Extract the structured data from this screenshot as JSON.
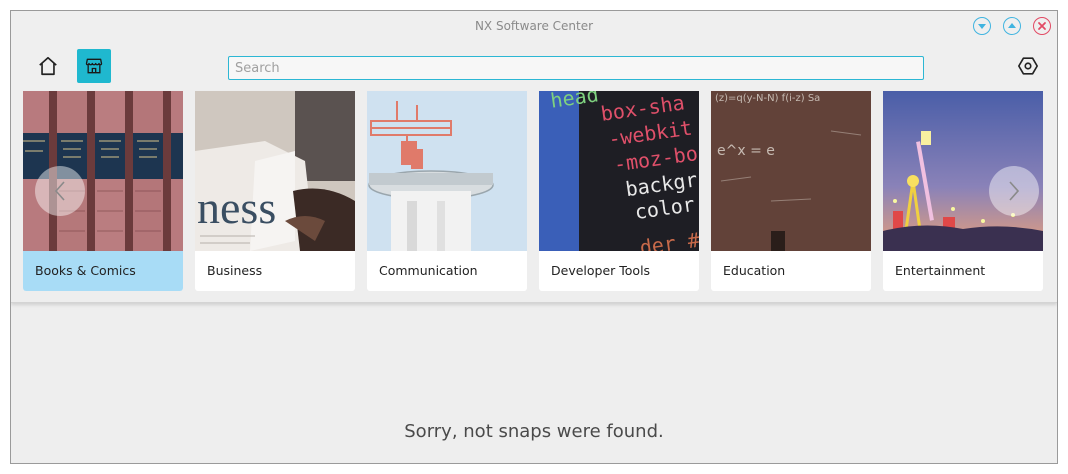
{
  "window": {
    "title": "NX Software Center"
  },
  "toolbar": {
    "search_placeholder": "Search"
  },
  "categories": [
    {
      "label": "Books & Comics",
      "selected": true
    },
    {
      "label": "Business",
      "selected": false
    },
    {
      "label": "Communication",
      "selected": false
    },
    {
      "label": "Developer Tools",
      "selected": false
    },
    {
      "label": "Education",
      "selected": false
    },
    {
      "label": "Entertainment",
      "selected": false
    }
  ],
  "card_text": {
    "business_word": "ness",
    "code_lines": [
      "head",
      "box-sha",
      "-webkit",
      "-moz-bo",
      "backgr",
      "color",
      "der #"
    ],
    "chalk_formula": "(z)=q(y-N-N) f(i-z) Sa",
    "chalk_eq": "e^x = e"
  },
  "main": {
    "empty_message": "Sorry, not snaps were found."
  },
  "colors": {
    "accent": "#1fb8cf",
    "selected_card": "#a8dcf6",
    "close": "#e24a64",
    "window_control": "#40b4e0"
  }
}
